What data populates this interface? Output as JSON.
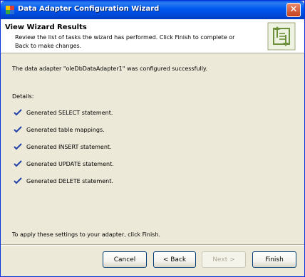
{
  "window": {
    "title": "Data Adapter Configuration Wizard",
    "close_label": "✕"
  },
  "header": {
    "title": "View Wizard Results",
    "description": "Review the list of tasks the wizard has performed. Click Finish to complete or Back to make changes."
  },
  "content": {
    "success_message": "The data adapter \"oleDbDataAdapter1\" was configured successfully.",
    "details_label": "Details:",
    "details": [
      "Generated SELECT statement.",
      "Generated table mappings.",
      "Generated INSERT statement.",
      "Generated UPDATE statement.",
      "Generated DELETE statement."
    ],
    "apply_message": "To apply these settings to your adapter, click Finish."
  },
  "buttons": {
    "cancel": "Cancel",
    "back": "< Back",
    "next": "Next >",
    "finish": "Finish"
  },
  "colors": {
    "titlebar": "#0058ee",
    "dialog_bg": "#ece9d8",
    "check": "#1f3fa8",
    "graphic_green": "#6b8f3a"
  }
}
